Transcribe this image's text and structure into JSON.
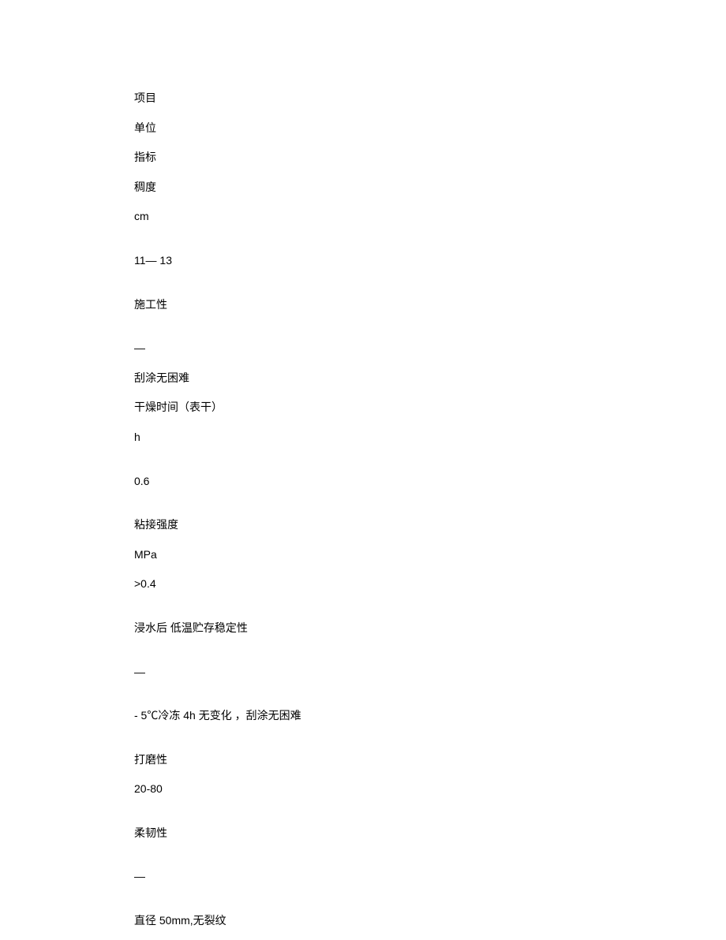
{
  "lines": [
    {
      "text": "项目",
      "class": "line"
    },
    {
      "text": "单位",
      "class": "line"
    },
    {
      "text": "指标",
      "class": "line"
    },
    {
      "text": "稠度",
      "class": "line"
    },
    {
      "text": "cm",
      "class": "line gap latin"
    },
    {
      "text": "11— 13",
      "class": "line gap latin"
    },
    {
      "text": "施工性",
      "class": "line gap"
    },
    {
      "text": "—",
      "class": "line"
    },
    {
      "text": "刮涂无困难",
      "class": "line"
    },
    {
      "text": "干燥时间（表干）",
      "class": "line"
    },
    {
      "text": "h",
      "class": "line gap latin"
    },
    {
      "text": "0.6",
      "class": "line gap latin"
    },
    {
      "text": "粘接强度",
      "class": "line"
    },
    {
      "text": "MPa",
      "class": "line latin"
    },
    {
      "text": ">0.4",
      "class": "line gap latin"
    },
    {
      "text": "浸水后  低温贮存稳定性",
      "class": "line gap"
    },
    {
      "text": "—",
      "class": "line gap"
    },
    {
      "text": "- 5℃冷冻 4h 无变化 ，刮涂无困难",
      "class": "line gap"
    },
    {
      "text": "打磨性",
      "class": "line"
    },
    {
      "text": "20-80",
      "class": "line gap latin"
    },
    {
      "text": "柔韧性",
      "class": "line gap"
    },
    {
      "text": "—",
      "class": "line gap"
    },
    {
      "text": "直径 50mm,无裂纹",
      "class": "line"
    }
  ]
}
